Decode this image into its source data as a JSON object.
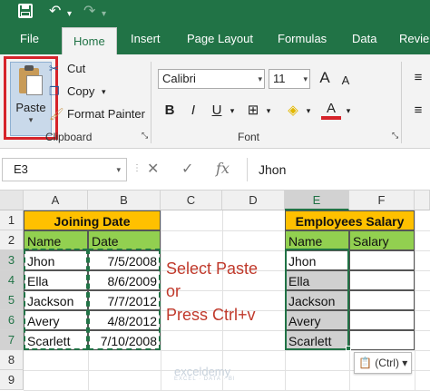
{
  "quick_access": {
    "save_icon": "save-icon",
    "undo_icon": "undo-icon",
    "redo_icon": "redo-icon"
  },
  "menu": {
    "file": "File",
    "home": "Home",
    "insert": "Insert",
    "page_layout": "Page Layout",
    "formulas": "Formulas",
    "data": "Data",
    "review": "Revie"
  },
  "ribbon": {
    "paste_label": "Paste",
    "cut_label": "Cut",
    "copy_label": "Copy",
    "format_painter_label": "Format Painter",
    "clipboard_group": "Clipboard",
    "font_group": "Font",
    "font_name": "Calibri",
    "font_size": "11",
    "bold": "B",
    "italic": "I",
    "underline": "U",
    "grow_font": "A",
    "shrink_font": "A",
    "font_color_letter": "A"
  },
  "formula_bar": {
    "name_box": "E3",
    "cancel": "✕",
    "enter": "✓",
    "fx": "fx",
    "content": "Jhon"
  },
  "grid": {
    "columns": [
      "A",
      "B",
      "C",
      "D",
      "E",
      "F"
    ],
    "rows": [
      "1",
      "2",
      "3",
      "4",
      "5",
      "6",
      "7",
      "8",
      "9"
    ],
    "joining_header": "Joining Date",
    "salary_header": "Employees Salary",
    "left_headers": {
      "name": "Name",
      "date": "Date"
    },
    "right_headers": {
      "name": "Name",
      "salary": "Salary"
    },
    "left_rows": [
      {
        "name": "Jhon",
        "date": "7/5/2008"
      },
      {
        "name": "Ella",
        "date": "8/6/2009"
      },
      {
        "name": "Jackson",
        "date": "7/7/2012"
      },
      {
        "name": "Avery",
        "date": "4/8/2012"
      },
      {
        "name": "Scarlett",
        "date": "7/10/2008"
      }
    ],
    "right_rows": [
      "Jhon",
      "Ella",
      "Jackson",
      "Avery",
      "Scarlett"
    ],
    "instructions": [
      "Select Paste",
      "or",
      "Press Ctrl+v"
    ],
    "paste_options": "(Ctrl) ▾",
    "watermark": "exceldemy",
    "watermark_sub": "EXCEL · DATA · BI"
  },
  "colors": {
    "excel_green": "#217346",
    "header_orange": "#ffc000",
    "header_green": "#92d050",
    "instruction_red": "#c0392b"
  }
}
